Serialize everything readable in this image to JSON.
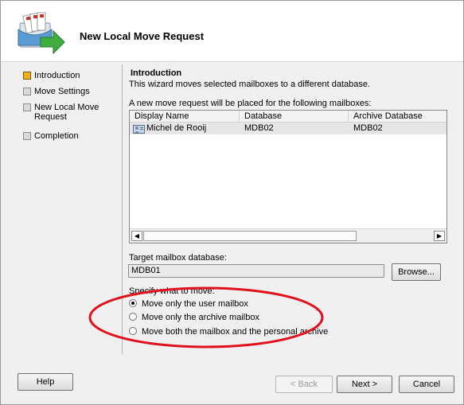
{
  "header": {
    "title": "New Local Move Request",
    "icon": "mailbox-move-icon"
  },
  "steps": [
    {
      "label": "Introduction",
      "active": true
    },
    {
      "label": "Move Settings",
      "active": false
    },
    {
      "label": "New Local Move Request",
      "active": false
    },
    {
      "label": "Completion",
      "active": false
    }
  ],
  "introduction": {
    "title": "Introduction",
    "description": "This wizard moves selected mailboxes to a different database.",
    "list_caption": "A new move request will be placed for the following mailboxes:"
  },
  "mailbox_list": {
    "columns": [
      "Display Name",
      "Database",
      "Archive Database"
    ],
    "rows": [
      {
        "display_name": "Michel de Rooij",
        "database": "MDB02",
        "archive_database": "MDB02"
      }
    ]
  },
  "target": {
    "label": "Target mailbox database:",
    "value": "MDB01",
    "browse_label": "Browse..."
  },
  "specify": {
    "label": "Specify what to move:",
    "options": [
      {
        "label": "Move only the user mailbox",
        "checked": true
      },
      {
        "label": "Move only the archive mailbox",
        "checked": false
      },
      {
        "label": "Move both the mailbox and the personal archive",
        "checked": false
      }
    ]
  },
  "footer": {
    "help_label": "Help",
    "back_label": "< Back",
    "next_label": "Next >",
    "cancel_label": "Cancel"
  },
  "colors": {
    "annotation": "#e0101c",
    "active_step": "#f2b01e"
  }
}
